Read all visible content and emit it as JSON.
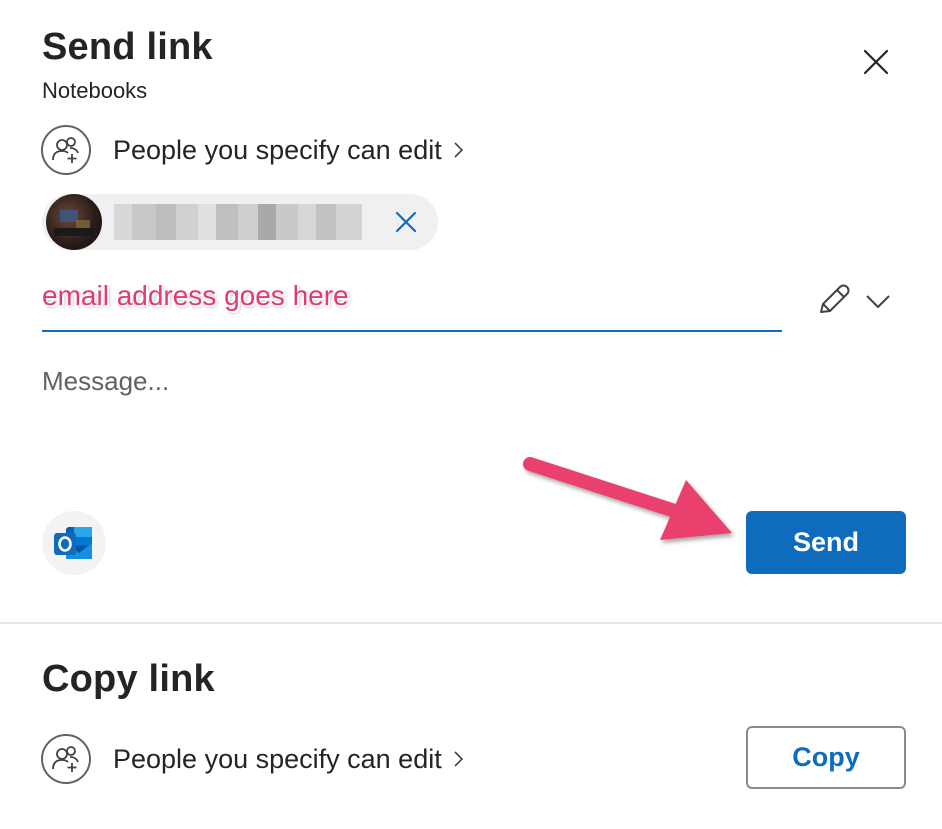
{
  "send_link": {
    "title": "Send link",
    "subtitle": "Notebooks",
    "permission_text": "People you specify can edit",
    "recipient_chip": {
      "name": ""
    },
    "email_overlay": "email address goes here",
    "message_placeholder": "Message...",
    "send_label": "Send"
  },
  "copy_link": {
    "title": "Copy link",
    "permission_text": "People you specify can edit",
    "copy_label": "Copy"
  },
  "colors": {
    "accent": "#0f6cbd",
    "annotation": "#e43b6e"
  },
  "icons": {
    "close": "close-icon",
    "people": "people-add-icon",
    "chevron": "chevron-right-icon",
    "remove": "dismiss-icon",
    "pencil": "pencil-icon",
    "dropdown": "chevron-down-icon",
    "outlook": "outlook-icon"
  }
}
